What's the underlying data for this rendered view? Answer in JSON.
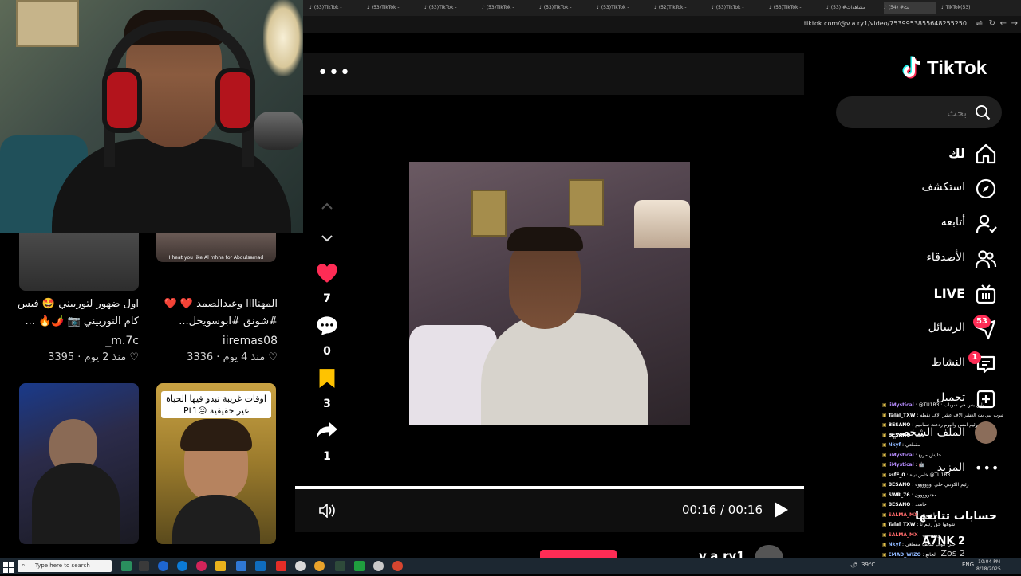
{
  "browser": {
    "tabs": [
      {
        "label": "(53)TikTok -"
      },
      {
        "label": "(53)TikTok -"
      },
      {
        "label": "(53)TikTok -"
      },
      {
        "label": "(53)TikTok -"
      },
      {
        "label": "(53)TikTok -"
      },
      {
        "label": "(53)TikTok -"
      },
      {
        "label": "(52)TikTok -"
      },
      {
        "label": "(53)TikTok -"
      },
      {
        "label": "(53)TikTok -"
      },
      {
        "label": "(53) #مشاهدات"
      },
      {
        "label": "(54) #بث"
      },
      {
        "label": "TikTok(53)"
      }
    ],
    "url": "tiktok.com/@v.a.ry1/video/7539953855648255250"
  },
  "feed": {
    "cards": [
      {
        "caption": "اول ضهور لتوربيني 🤩 فيس كام التوربيني 📷 🌶️🔥 ...",
        "user": "_m.7c",
        "meta": "منذ 2 يوم",
        "likes": "3395"
      },
      {
        "caption": "المهناااا وعبدالصمد ❤️ ❤️ #شونق #ابوسويحل...",
        "user": "iiremas08",
        "meta": "منذ 4 يوم",
        "likes": "3336",
        "thumb_text": "I heat you like Al mhna for Abdulsamad"
      },
      {
        "caption": "",
        "user": "",
        "meta": "",
        "likes": ""
      },
      {
        "caption": "",
        "user": "",
        "meta": "",
        "likes": "",
        "thumb_text": "اوقات غريبة تبدو فيها الحياة غير حقيقية 😔Pt1"
      }
    ]
  },
  "video": {
    "likes": "7",
    "comments": "0",
    "saves": "3",
    "shares": "1",
    "time": "00:16 / 00:16",
    "author": "v.a.ry1",
    "more_label": "•••"
  },
  "sidebar": {
    "logo": "TikTok",
    "search_placeholder": "بحث",
    "nav": [
      {
        "label": "لك"
      },
      {
        "label": "استكشف"
      },
      {
        "label": "أتابعه"
      },
      {
        "label": "الأصدقاء"
      },
      {
        "label": "LIVE"
      },
      {
        "label": "الرسائل",
        "badge": "53"
      },
      {
        "label": "النشاط",
        "badge": "1"
      },
      {
        "label": "تحميل"
      },
      {
        "label": "الملف الشخصي"
      },
      {
        "label": "المزيد"
      }
    ],
    "following_title": "حسابات تتابعها",
    "following_first": "A7NK 2",
    "following_second": "Zos 2"
  },
  "chat": [
    {
      "name": "iiMystical",
      "text": "@TU1B3 : يابن بس هي سوباب",
      "color": "#b78cff"
    },
    {
      "name": "Talal_TXW",
      "text": "تيوب نبي بث العشر الاف عشر الاف نفظه",
      "color": "#ffffff"
    },
    {
      "name": "BESANO",
      "text": "رئيم امس واليوم ردعت تصاميم",
      "color": "#ffffff"
    },
    {
      "name": "BESANO",
      "text": "بحت",
      "color": "#ffffff"
    },
    {
      "name": "Nkyf",
      "text": "مقطعي",
      "color": "#8fb8ff"
    },
    {
      "name": "iiMystical",
      "text": "حليش مربع",
      "color": "#b78cff"
    },
    {
      "name": "iiMystical",
      "text": "🤖",
      "color": "#b78cff"
    },
    {
      "name": "ssfF_0",
      "text": "خاص نياه @TU1B3",
      "color": "#ffffff"
    },
    {
      "name": "BESANO",
      "text": "رئيم الكونتي حلي اووووووه",
      "color": "#ffffff"
    },
    {
      "name": "SWR_76",
      "text": "مجنووووون",
      "color": "#ffffff"
    },
    {
      "name": "BESANO",
      "text": "حامدد",
      "color": "#ffffff"
    },
    {
      "name": "SALMA_MX",
      "text": "ما تروح",
      "color": "#ff6b6b"
    },
    {
      "name": "Talal_TXW",
      "text": "شوفها حق رئيم نا",
      "color": "#ffffff"
    },
    {
      "name": "SALMA_MX",
      "text": "وييييييييي",
      "color": "#ff6b6b"
    },
    {
      "name": "Nkyf",
      "text": "حتى الوف سالف مقطعي",
      "color": "#8fb8ff"
    },
    {
      "name": "EMAD_WIZO",
      "text": "الجانع",
      "color": "#8fb8ff"
    },
    {
      "name": "SALMA_MX",
      "text": "بسلام عليكم ورحمة الله وبركاته",
      "color": "#ff6b6b"
    }
  ],
  "taskbar": {
    "search_placeholder": "Type here to search",
    "weather": "39°C",
    "lang": "ENG",
    "time": "10:04 PM",
    "date": "8/18/2025"
  },
  "colors": {
    "accent": "#fe2c55",
    "save": "#ffc300",
    "background": "#000000"
  }
}
